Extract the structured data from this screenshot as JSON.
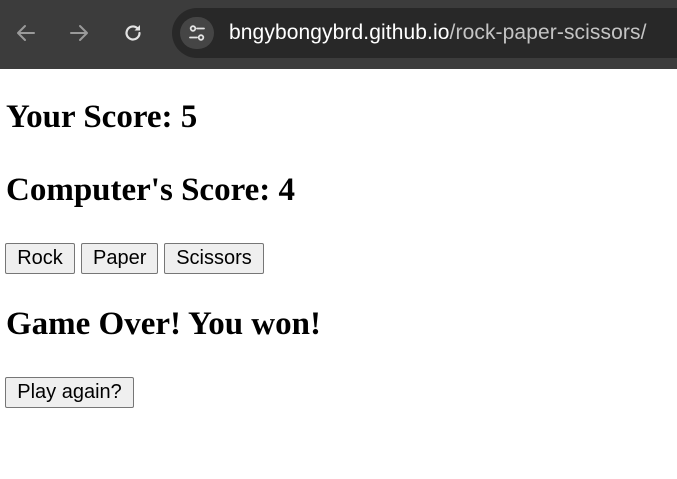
{
  "browser": {
    "url_host": "bngybongybrd.github.io",
    "url_path": "/rock-paper-scissors/"
  },
  "game": {
    "your_score_label": "Your Score: 5",
    "computer_score_label": "Computer's Score: 4",
    "choices": {
      "rock": "Rock",
      "paper": "Paper",
      "scissors": "Scissors"
    },
    "result_message": "Game Over! You won!",
    "play_again_label": "Play again?"
  }
}
